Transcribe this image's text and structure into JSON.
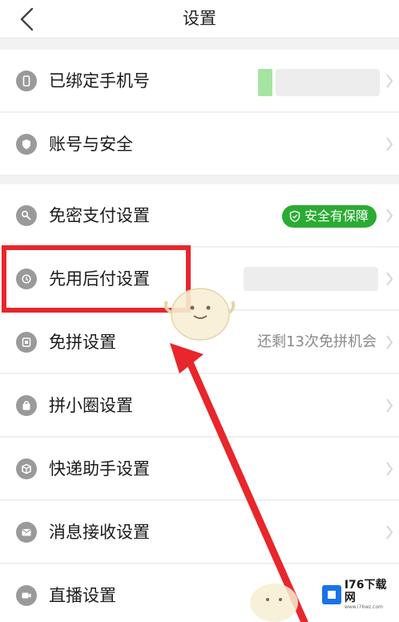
{
  "header": {
    "title": "设置",
    "back_icon": "chevron-left-icon"
  },
  "rows": [
    {
      "label": "已绑定手机号",
      "icon": "phone-icon"
    },
    {
      "label": "账号与安全",
      "icon": "shield-icon"
    },
    {
      "label": "免密支付设置",
      "icon": "key-icon",
      "badge": "安全有保障"
    },
    {
      "label": "先用后付设置",
      "icon": "pay-later-icon"
    },
    {
      "label": "免拼设置",
      "icon": "group-free-icon",
      "right_text": "还剩13次免拼机会"
    },
    {
      "label": "拼小圈设置",
      "icon": "bag-icon"
    },
    {
      "label": "快递助手设置",
      "icon": "package-icon"
    },
    {
      "label": "消息接收设置",
      "icon": "message-icon"
    },
    {
      "label": "直播设置",
      "icon": "video-icon"
    }
  ],
  "watermark": {
    "brand": "I76下载网",
    "site": "www.i76wz.com"
  },
  "colors": {
    "badge_green": "#2aab32",
    "annotation_red": "#e8262b",
    "icon_gray": "#9a9a9a"
  }
}
